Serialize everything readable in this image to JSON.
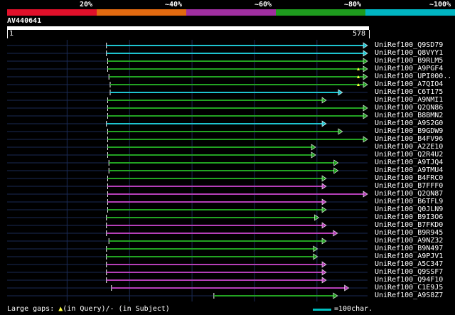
{
  "legend": {
    "segments": [
      {
        "label": "20%",
        "color": "#e0102a"
      },
      {
        "label": "~40%",
        "color": "#e26a10"
      },
      {
        "label": "~60%",
        "color": "#9f2fa0"
      },
      {
        "label": "~80%",
        "color": "#1e9b1e"
      },
      {
        "label": "~100%",
        "color": "#00b4c2"
      }
    ]
  },
  "query": {
    "name": "AV440641",
    "start": "1",
    "end": "578"
  },
  "colors": {
    "identity_100": "#1ec4d0",
    "identity_80": "#22a322",
    "identity_60": "#b53fb8",
    "grid": "#1a2a55"
  },
  "hits": [
    {
      "name": "UniRef100_Q9SD79",
      "start": 160,
      "end": 578,
      "identity": 100
    },
    {
      "name": "UniRef100_Q8VYY1",
      "start": 160,
      "end": 578,
      "identity": 100
    },
    {
      "name": "UniRef100_B9RLM5",
      "start": 162,
      "end": 578,
      "identity": 80
    },
    {
      "name": "UniRef100_A9PGF4",
      "start": 162,
      "end": 578,
      "identity": 80,
      "gap": true
    },
    {
      "name": "UniRef100_UPI000..",
      "start": 164,
      "end": 578,
      "identity": 80,
      "gap": true
    },
    {
      "name": "UniRef100_A7QIO4",
      "start": 166,
      "end": 578,
      "identity": 80,
      "gap": true
    },
    {
      "name": "UniRef100_C6T175",
      "start": 166,
      "end": 538,
      "identity": 100
    },
    {
      "name": "UniRef100_A9NMI1",
      "start": 162,
      "end": 512,
      "identity": 80
    },
    {
      "name": "UniRef100_Q2QN86",
      "start": 162,
      "end": 578,
      "identity": 80
    },
    {
      "name": "UniRef100_B8BMN2",
      "start": 162,
      "end": 578,
      "identity": 80
    },
    {
      "name": "UniRef100_A9S2G0",
      "start": 160,
      "end": 512,
      "identity": 100
    },
    {
      "name": "UniRef100_B9GDW9",
      "start": 162,
      "end": 538,
      "identity": 80
    },
    {
      "name": "UniRef100_B4FV96",
      "start": 162,
      "end": 578,
      "identity": 80
    },
    {
      "name": "UniRef100_A2ZE10",
      "start": 162,
      "end": 495,
      "identity": 80
    },
    {
      "name": "UniRef100_Q2R4U2",
      "start": 162,
      "end": 495,
      "identity": 80
    },
    {
      "name": "UniRef100_A9TJQ4",
      "start": 164,
      "end": 531,
      "identity": 80
    },
    {
      "name": "UniRef100_A9TMU4",
      "start": 164,
      "end": 531,
      "identity": 80
    },
    {
      "name": "UniRef100_B4FRC0",
      "start": 162,
      "end": 512,
      "identity": 80
    },
    {
      "name": "UniRef100_B7FFF0",
      "start": 162,
      "end": 512,
      "identity": 60
    },
    {
      "name": "UniRef100_Q2QN87",
      "start": 162,
      "end": 578,
      "identity": 60
    },
    {
      "name": "UniRef100_B6TFL9",
      "start": 162,
      "end": 512,
      "identity": 60
    },
    {
      "name": "UniRef100_Q0JLN9",
      "start": 162,
      "end": 512,
      "identity": 80
    },
    {
      "name": "UniRef100_B9I3O6",
      "start": 160,
      "end": 500,
      "identity": 80
    },
    {
      "name": "UniRef100_B7FKD0",
      "start": 160,
      "end": 512,
      "identity": 60
    },
    {
      "name": "UniRef100_B9R945",
      "start": 160,
      "end": 530,
      "identity": 60
    },
    {
      "name": "UniRef100_A9NZ32",
      "start": 164,
      "end": 512,
      "identity": 80
    },
    {
      "name": "UniRef100_B9N497",
      "start": 160,
      "end": 498,
      "identity": 80
    },
    {
      "name": "UniRef100_A9PJV1",
      "start": 160,
      "end": 498,
      "identity": 80
    },
    {
      "name": "UniRef100_A5C347",
      "start": 160,
      "end": 512,
      "identity": 60
    },
    {
      "name": "UniRef100_Q9SSF7",
      "start": 160,
      "end": 512,
      "identity": 60
    },
    {
      "name": "UniRef100_Q94F10",
      "start": 160,
      "end": 512,
      "identity": 60
    },
    {
      "name": "UniRef100_C1E9J5",
      "start": 168,
      "end": 548,
      "identity": 60
    },
    {
      "name": "UniRef100_A9S8Z7",
      "start": 332,
      "end": 530,
      "identity": 80
    }
  ],
  "footer": {
    "gaps_prefix": "Large gaps: ",
    "gaps_query_icon": "▲",
    "gaps_suffix": "(in Query)/- (in Subject)",
    "scale_label": "=100char."
  }
}
